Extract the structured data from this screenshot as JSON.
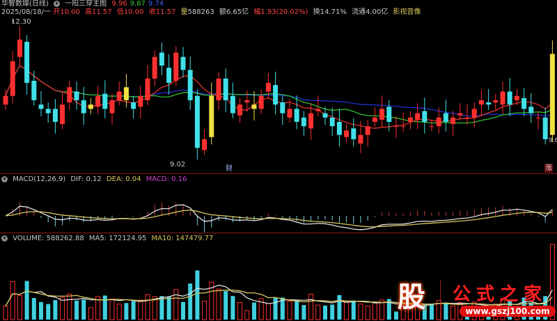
{
  "header": {
    "stock_name": "华智数媒(日线)",
    "indicator_name": "一阳三穿主图",
    "ind_values": [
      "9.96",
      "9.87",
      "9.74"
    ],
    "date": "2025/08/18/一",
    "open_label": "开",
    "open": "10.00",
    "high_label": "高",
    "high": "11.57",
    "low_label": "低",
    "low": "10.00",
    "close_label": "收",
    "close": "11.57",
    "vol_label": "量",
    "vol": "588263",
    "amt_label": "额",
    "amt": "6.65亿",
    "chg_label": "幅",
    "chg": "1.93(20.02%)",
    "turn_label": "换",
    "turn": "14.71%",
    "float_label": "流通",
    "float": "4.00亿",
    "sector": "影视音像"
  },
  "price_marks": {
    "high": "12.30",
    "low": "9.02",
    "last": "9.6"
  },
  "badges": {
    "cai": "财",
    "zhang": "涨"
  },
  "macd": {
    "title": "MACD(12,26,9)",
    "dif": "DIF: 0.12",
    "dea": "DEA: 0.04",
    "macd": "MACD: 0.16"
  },
  "volume": {
    "title": "VOLUME: 588262.88",
    "ma5": "MA5: 172124.95",
    "ma10": "MA10: 147479.77"
  },
  "watermark": {
    "logo": "股",
    "name": "公式之家",
    "url": "www.gszj100.com"
  },
  "colors": {
    "up": "#ff3030",
    "down": "#40e0e8",
    "signal": "#f0e040",
    "ma5": "#e03030",
    "ma10": "#30c030",
    "ma20": "#2030d0"
  },
  "closes": [
    10.6,
    11.4,
    11.9,
    10.9,
    10.5,
    10.3,
    10.2,
    10.0,
    10.4,
    10.8,
    10.5,
    10.2,
    10.4,
    10.6,
    10.3,
    10.5,
    10.7,
    10.5,
    10.3,
    10.6,
    11.0,
    11.5,
    11.3,
    10.9,
    11.6,
    11.2,
    10.5,
    9.4,
    9.6,
    10.6,
    11.0,
    10.5,
    10.2,
    10.4,
    10.5,
    10.3,
    10.6,
    10.9,
    10.4,
    10.2,
    10.3,
    10.0,
    9.9,
    10.2,
    10.3,
    10.1,
    9.9,
    9.7,
    9.8,
    9.6,
    9.7,
    9.9,
    10.1,
    10.3,
    10.0,
    9.9,
    9.9,
    10.1,
    10.2,
    10.0,
    9.9,
    10.1,
    10.0,
    10.1,
    10.2,
    10.1,
    10.3,
    10.5,
    10.4,
    10.5,
    10.7,
    10.4,
    10.6,
    10.3,
    10.2,
    10.1,
    9.6,
    11.57
  ],
  "signal_bars": [
    12,
    17,
    29,
    35
  ]
}
